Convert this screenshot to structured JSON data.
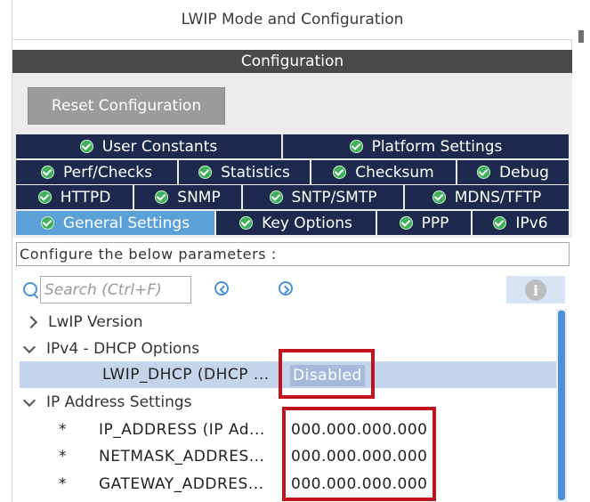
{
  "window": {
    "title": "LWIP Mode and Configuration"
  },
  "config_header": "Configuration",
  "reset_button": "Reset Configuration",
  "tabs": [
    {
      "label": "User Constants",
      "active": false
    },
    {
      "label": "Platform Settings",
      "active": false
    },
    {
      "label": "Perf/Checks",
      "active": false
    },
    {
      "label": "Statistics",
      "active": false
    },
    {
      "label": "Checksum",
      "active": false
    },
    {
      "label": "Debug",
      "active": false
    },
    {
      "label": "HTTPD",
      "active": false
    },
    {
      "label": "SNMP",
      "active": false
    },
    {
      "label": "SNTP/SMTP",
      "active": false
    },
    {
      "label": "MDNS/TFTP",
      "active": false
    },
    {
      "label": "General Settings",
      "active": true
    },
    {
      "label": "Key Options",
      "active": false
    },
    {
      "label": "PPP",
      "active": false
    },
    {
      "label": "IPv6",
      "active": false
    }
  ],
  "description": "Configure the below parameters :",
  "search": {
    "placeholder": "Search (Ctrl+F)"
  },
  "info_icon": "i",
  "tree": {
    "lwip_version": "LwIP Version",
    "ipv4_dhcp": "IPv4 - DHCP Options",
    "lwip_dhcp_name": "LWIP_DHCP (DHCP ...",
    "lwip_dhcp_value": "Disabled",
    "ip_address_settings": "IP Address Settings",
    "bullet": "*",
    "ip_address_name": "IP_ADDRESS (IP Ad...",
    "ip_address_value": "000.000.000.000",
    "netmask_name": "NETMASK_ADDRES...",
    "netmask_value": "000.000.000.000",
    "gateway_name": "GATEWAY_ADDRES...",
    "gateway_value": "000.000.000.000"
  },
  "colors": {
    "tab_bg": "#1d2a4e",
    "tab_active_bg": "#5ca0d8",
    "check_green": "#3fb15a",
    "highlight_red": "#c0141c",
    "selection_bg": "#c4d4ea"
  }
}
